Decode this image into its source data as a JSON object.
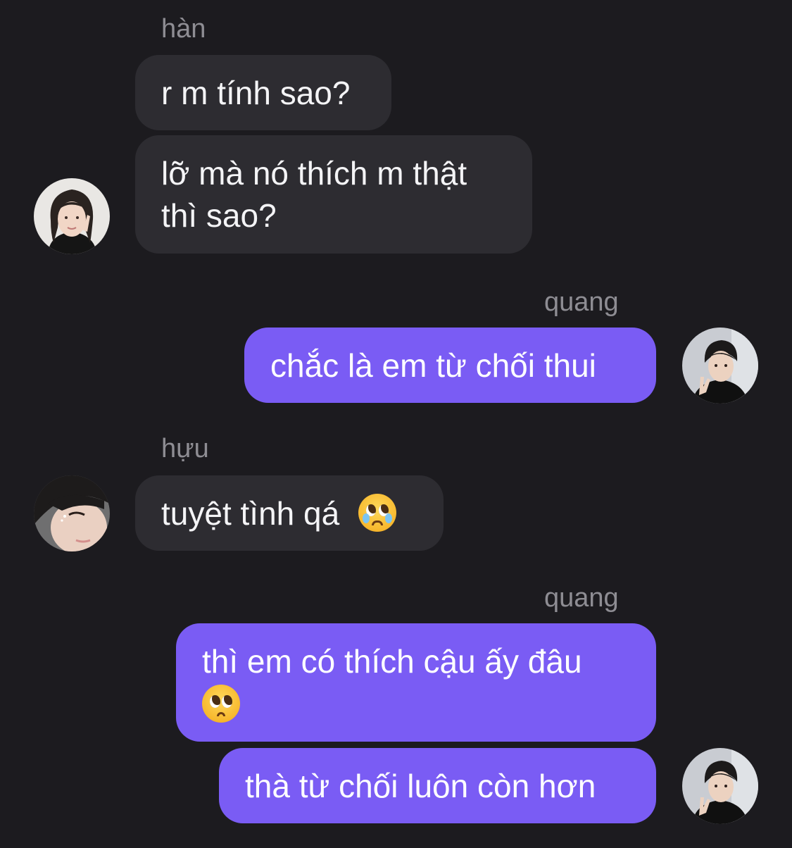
{
  "chat": {
    "groups": [
      {
        "sender": "hàn",
        "messages": [
          {
            "lines": [
              "r m tính sao?"
            ]
          },
          {
            "lines": [
              "lỡ mà nó thích m thật",
              "thì sao?"
            ]
          }
        ]
      },
      {
        "sender": "quang",
        "messages": [
          {
            "lines": [
              "chắc là em từ chối thui"
            ]
          }
        ]
      },
      {
        "sender": "hựu",
        "messages": [
          {
            "lines": [
              "tuyệt tình qá"
            ],
            "emoji": "crying-face-emoji"
          }
        ]
      },
      {
        "sender": "quang",
        "messages": [
          {
            "lines": [
              "thì em có thích cậu ấy đâu"
            ],
            "emoji": "pleading-face-emoji"
          },
          {
            "lines": [
              "thà từ chối luôn còn hơn"
            ]
          }
        ]
      }
    ]
  },
  "colors": {
    "background": "#1c1b1f",
    "incoming_bubble": "#2d2c31",
    "outgoing_bubble": "#7a5cf4",
    "sender_name": "#8e8d93"
  },
  "icons": [
    "avatar-han",
    "avatar-quang",
    "avatar-huu",
    "crying-face-emoji",
    "pleading-face-emoji"
  ]
}
